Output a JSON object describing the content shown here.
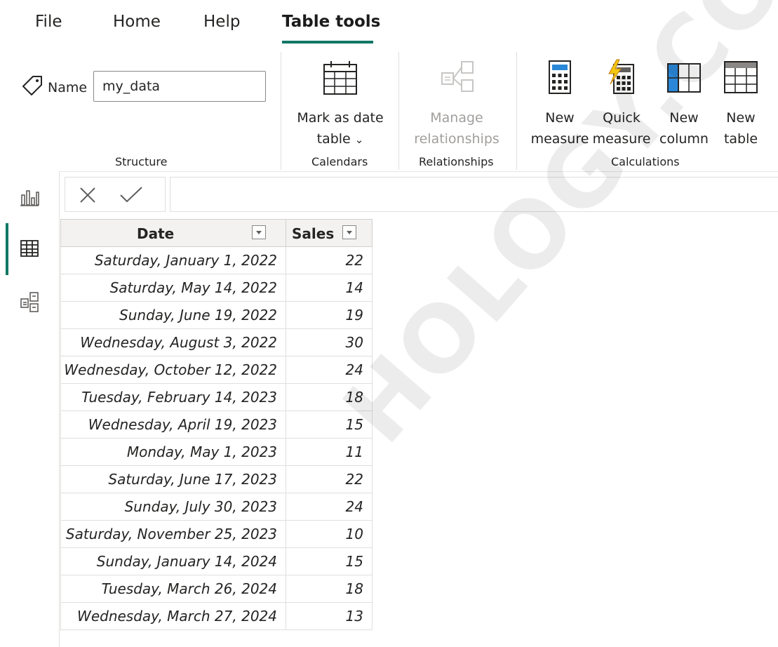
{
  "menu": {
    "tabs": [
      {
        "label": "File"
      },
      {
        "label": "Home"
      },
      {
        "label": "Help"
      },
      {
        "label": "Table tools"
      }
    ],
    "active_tab": "Table tools",
    "accent_color": "#117865"
  },
  "ribbon": {
    "structure": {
      "name_label": "Name",
      "name_value": "my_data",
      "group_label": "Structure"
    },
    "calendars": {
      "mark_date_line1": "Mark as date",
      "mark_date_line2": "table",
      "dropdown_glyph": "⌄",
      "group_label": "Calendars"
    },
    "relationships": {
      "manage_line1": "Manage",
      "manage_line2": "relationships",
      "group_label": "Relationships"
    },
    "calculations": {
      "new_measure_line1": "New",
      "new_measure_line2": "measure",
      "quick_measure_line1": "Quick",
      "quick_measure_line2": "measure",
      "new_column_line1": "New",
      "new_column_line2": "column",
      "new_table_line1": "New",
      "new_table_line2": "table",
      "group_label": "Calculations"
    }
  },
  "left_nav": {
    "items": [
      {
        "name": "report-view",
        "icon": "bar-chart-icon"
      },
      {
        "name": "table-view",
        "icon": "table-grid-icon",
        "active": true
      },
      {
        "name": "model-view",
        "icon": "model-icon"
      }
    ]
  },
  "formula_bar": {
    "cancel_icon": "close-icon",
    "commit_icon": "check-icon",
    "value": ""
  },
  "table": {
    "columns": [
      "Date",
      "Sales"
    ],
    "rows": [
      [
        "Saturday, January 1, 2022",
        "22"
      ],
      [
        "Saturday, May 14, 2022",
        "14"
      ],
      [
        "Sunday, June 19, 2022",
        "19"
      ],
      [
        "Wednesday, August 3, 2022",
        "30"
      ],
      [
        "Wednesday, October 12, 2022",
        "24"
      ],
      [
        "Tuesday, February 14, 2023",
        "18"
      ],
      [
        "Wednesday, April 19, 2023",
        "15"
      ],
      [
        "Monday, May 1, 2023",
        "11"
      ],
      [
        "Saturday, June 17, 2023",
        "22"
      ],
      [
        "Sunday, July 30, 2023",
        "24"
      ],
      [
        "Saturday, November 25, 2023",
        "10"
      ],
      [
        "Sunday, January 14, 2024",
        "15"
      ],
      [
        "Tuesday, March 26, 2024",
        "18"
      ],
      [
        "Wednesday, March 27, 2024",
        "13"
      ]
    ]
  },
  "watermark": {
    "text": "HOLOGY.CO"
  }
}
